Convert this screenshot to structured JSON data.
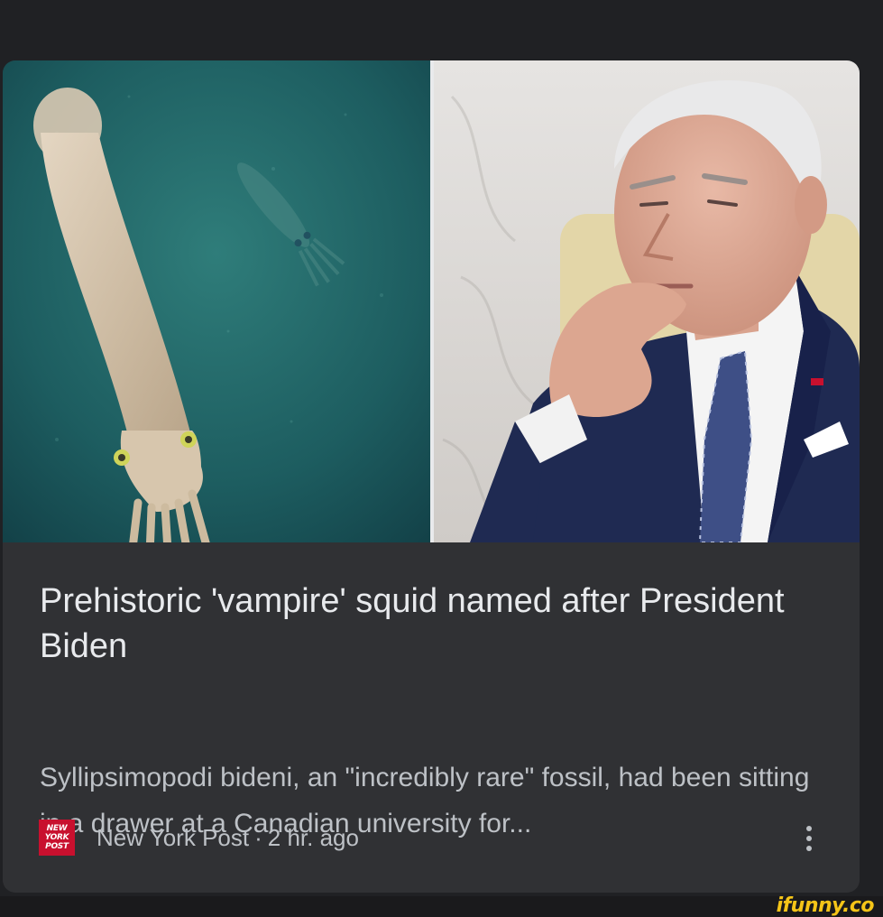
{
  "article": {
    "headline": "Prehistoric 'vampire' squid named after President Biden",
    "snippet": "Syllipsimopodi bideni, an \"incredibly rare\" fossil, had been sitting in a drawer at a Canadian university for...",
    "source": {
      "name": "New York Post",
      "separator": "·",
      "time": "2 hr. ago",
      "logo_lines": [
        "NEW",
        "YORK",
        "POST"
      ],
      "logo_color": "#c8102e"
    },
    "images": [
      {
        "icon": "squid-photo",
        "alt": "squid"
      },
      {
        "icon": "portrait-photo",
        "alt": "man in suit"
      }
    ],
    "menu_icon": "more-vert-icon"
  },
  "watermark": {
    "text": "ifunny.co",
    "color": "#f5c518"
  },
  "colors": {
    "background": "#202124",
    "card": "#303134",
    "headline": "#e8eaed",
    "snippet": "#bdc1c6"
  }
}
